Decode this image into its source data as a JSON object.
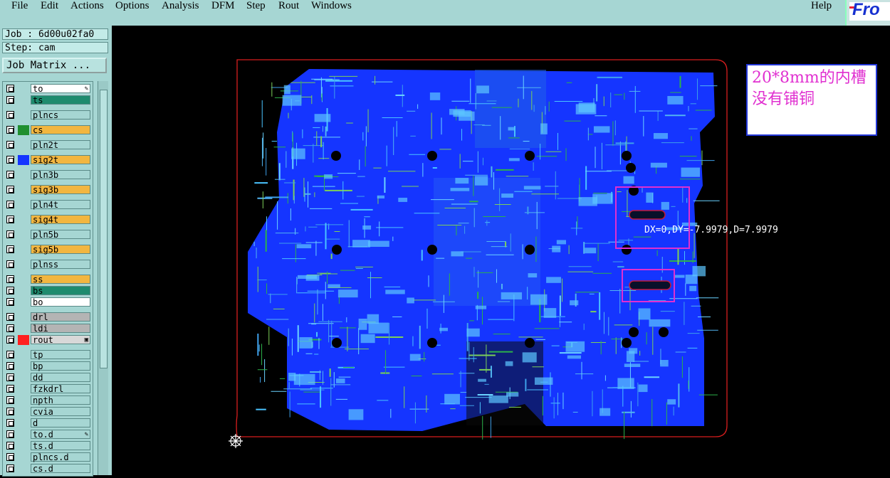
{
  "menubar": {
    "items": [
      "File",
      "Edit",
      "Actions",
      "Options",
      "Analysis",
      "DFM",
      "Step",
      "Rout",
      "Windows"
    ],
    "help": "Help"
  },
  "logo": {
    "text": "Fro",
    "icon": "frontline-logo-icon"
  },
  "job": {
    "label": "Job : 6d00u02fa0",
    "step": "Step: cam",
    "matrix_button": "Job Matrix ..."
  },
  "layers": [
    {
      "name": "to",
      "color": "#ffffff",
      "swatch": ""
    },
    {
      "name": "ts",
      "color": "#1e8b6e",
      "swatch": ""
    },
    {
      "name": "plncs",
      "color": "#a6d6d3",
      "swatch": ""
    },
    {
      "name": "cs",
      "color": "#f2b640",
      "swatch": "#1f8f2f"
    },
    {
      "name": "pln2t",
      "color": "#a6d6d3",
      "swatch": ""
    },
    {
      "name": "sig2t",
      "color": "#f2b640",
      "swatch": "#1535ff"
    },
    {
      "name": "pln3b",
      "color": "#a6d6d3",
      "swatch": ""
    },
    {
      "name": "sig3b",
      "color": "#f2b640",
      "swatch": ""
    },
    {
      "name": "pln4t",
      "color": "#a6d6d3",
      "swatch": ""
    },
    {
      "name": "sig4t",
      "color": "#f2b640",
      "swatch": ""
    },
    {
      "name": "pln5b",
      "color": "#a6d6d3",
      "swatch": ""
    },
    {
      "name": "sig5b",
      "color": "#f2b640",
      "swatch": ""
    },
    {
      "name": "plnss",
      "color": "#a6d6d3",
      "swatch": ""
    },
    {
      "name": "ss",
      "color": "#f2b640",
      "swatch": ""
    },
    {
      "name": "bs",
      "color": "#1e8b6e",
      "swatch": ""
    },
    {
      "name": "bo",
      "color": "#ffffff",
      "swatch": ""
    },
    {
      "name": "drl",
      "color": "#b4b4b4",
      "swatch": ""
    },
    {
      "name": "ldi",
      "color": "#b4b4b4",
      "swatch": ""
    },
    {
      "name": "rout",
      "color": "#d8d8d8",
      "swatch": "#ff2020"
    },
    {
      "name": "tp",
      "color": "#a6d6d3",
      "swatch": ""
    },
    {
      "name": "bp",
      "color": "#a6d6d3",
      "swatch": ""
    },
    {
      "name": "dd",
      "color": "#a6d6d3",
      "swatch": ""
    },
    {
      "name": "fzkdrl",
      "color": "#a6d6d3",
      "swatch": ""
    },
    {
      "name": "npth",
      "color": "#a6d6d3",
      "swatch": ""
    },
    {
      "name": "cvia",
      "color": "#a6d6d3",
      "swatch": ""
    },
    {
      "name": "d",
      "color": "#a6d6d3",
      "swatch": ""
    },
    {
      "name": "to.d",
      "color": "#a6d6d3",
      "swatch": ""
    },
    {
      "name": "ts.d",
      "color": "#a6d6d3",
      "swatch": ""
    },
    {
      "name": "plncs.d",
      "color": "#a6d6d3",
      "swatch": ""
    },
    {
      "name": "cs.d",
      "color": "#a6d6d3",
      "swatch": ""
    }
  ],
  "annotation": {
    "line1": "20*8mm的内槽",
    "line2": "没有铺铜"
  },
  "measurement": "DX=0,DY=-7.9979,D=7.9979",
  "colors": {
    "copper": "#1535ff",
    "outline": "#d81e1e",
    "highlight": "#e02fd0",
    "background": "#000000"
  }
}
